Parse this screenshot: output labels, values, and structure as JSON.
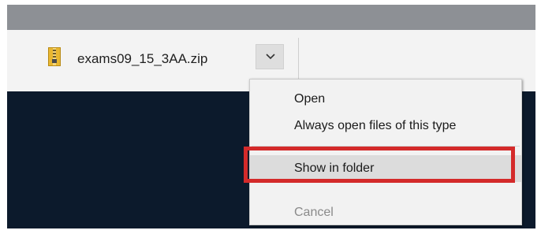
{
  "download_shelf": {
    "file_name": "exams09_15_3AA.zip",
    "file_icon": "zip-archive-icon",
    "dropdown_icon": "chevron-down-icon"
  },
  "context_menu": {
    "items": [
      {
        "label": "Open",
        "enabled": true
      },
      {
        "label": "Always open files of this type",
        "enabled": true
      },
      {
        "label": "Show in folder",
        "enabled": true,
        "highlighted": true
      },
      {
        "label": "Cancel",
        "enabled": false
      }
    ]
  },
  "colors": {
    "highlight_border": "#d42a2a",
    "shelf_background": "#f3f3f3",
    "desktop_background": "#0c1a2c"
  }
}
